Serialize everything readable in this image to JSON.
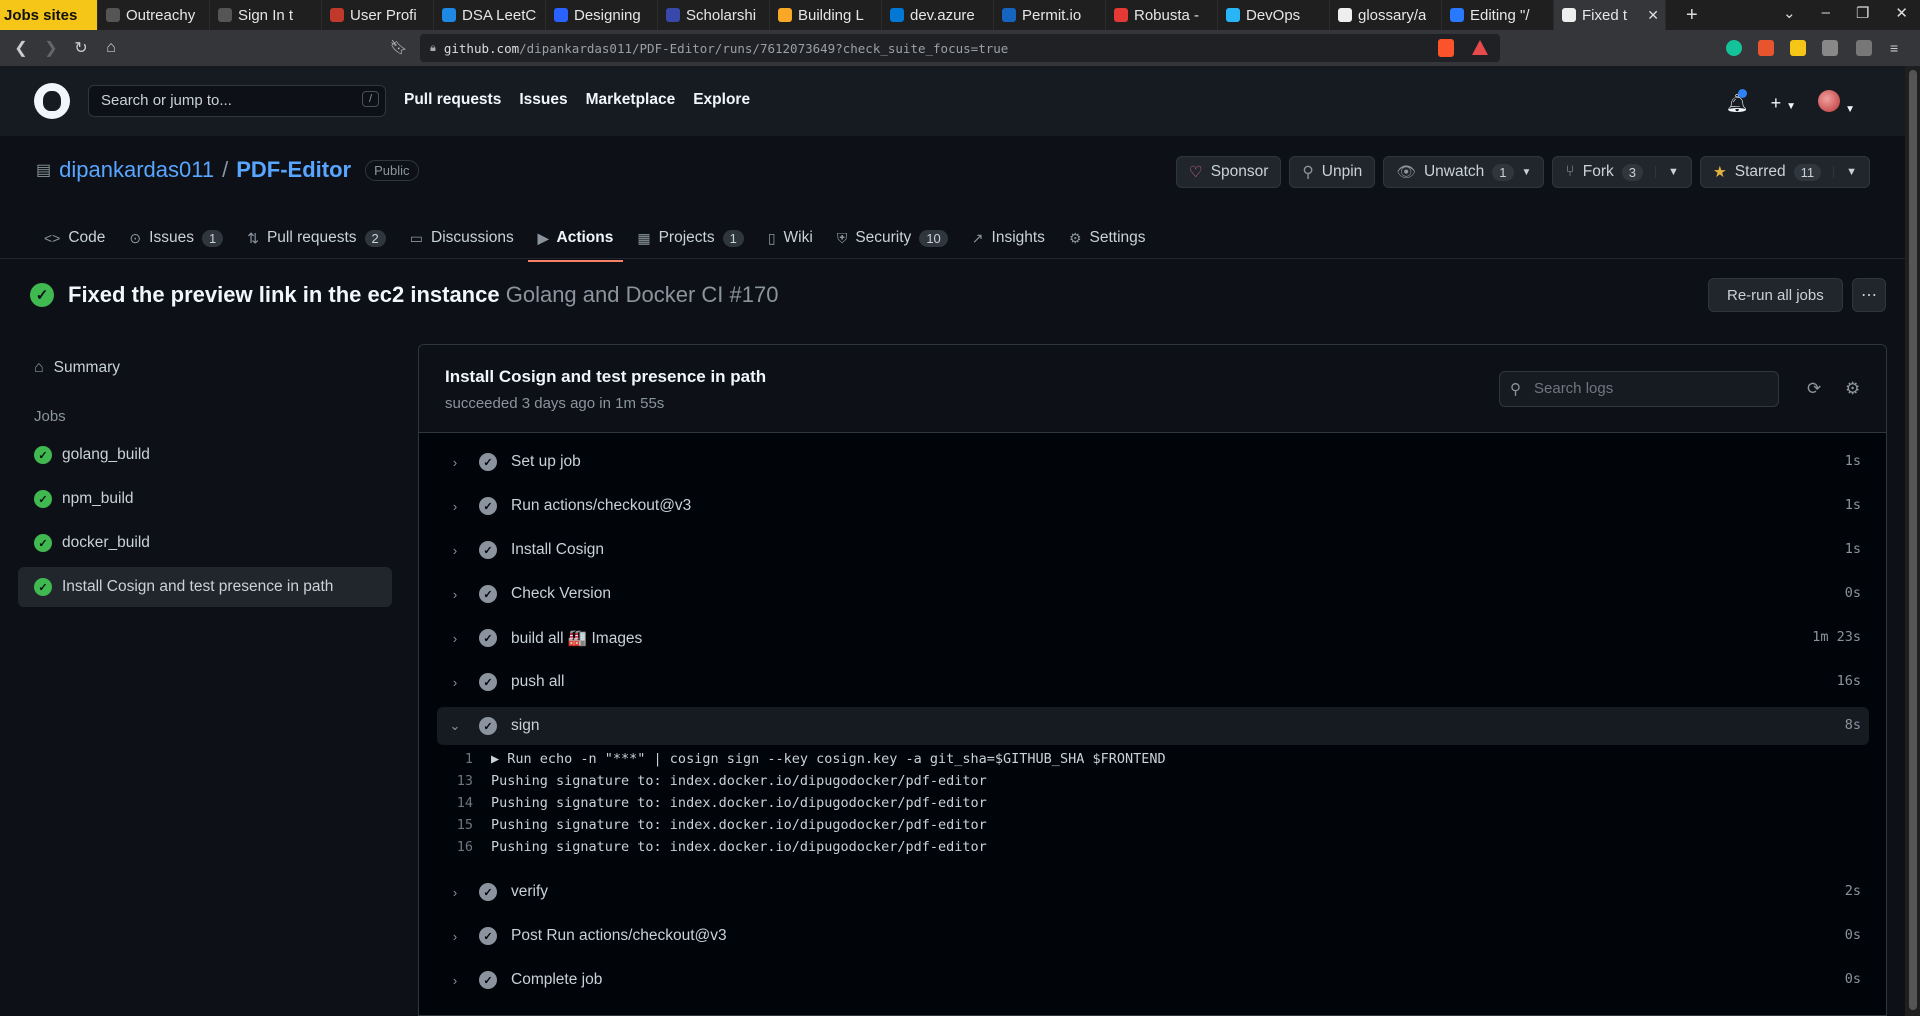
{
  "browser": {
    "tabs": [
      {
        "label": "Jobs sites",
        "color": "#f5c518"
      },
      {
        "label": "Outreachy",
        "color": "#555555"
      },
      {
        "label": "Sign In t",
        "color": "#555555"
      },
      {
        "label": "User Profi",
        "color": "#c0392b"
      },
      {
        "label": "DSA LeetCo",
        "color": "#1e88e5"
      },
      {
        "label": "Designing",
        "color": "#2962ff"
      },
      {
        "label": "Scholarshi",
        "color": "#3949ab"
      },
      {
        "label": "Building L",
        "color": "#f9a825"
      },
      {
        "label": "dev.azure",
        "color": "#0078d4"
      },
      {
        "label": "Permit.io",
        "color": "#1565c0"
      },
      {
        "label": "Robusta -",
        "color": "#e53935"
      },
      {
        "label": "DevOps",
        "color": "#29b6f6"
      },
      {
        "label": "glossary/a",
        "color": "#eeeeee"
      },
      {
        "label": "Editing \"/",
        "color": "#2979ff"
      },
      {
        "label": "Fixed t",
        "color": "#eeeeee"
      }
    ],
    "url_host": "github.com",
    "url_path": "/dipankardas011/PDF-Editor/runs/7612073649?check_suite_focus=true"
  },
  "header": {
    "search_placeholder": "Search or jump to...",
    "search_hint": "/",
    "nav": [
      "Pull requests",
      "Issues",
      "Marketplace",
      "Explore"
    ]
  },
  "repo": {
    "owner": "dipankardas011",
    "separator": "/",
    "name": "PDF-Editor",
    "visibility": "Public",
    "sponsor_label": "Sponsor",
    "unpin_label": "Unpin",
    "watch_label": "Unwatch",
    "watch_count": "1",
    "fork_label": "Fork",
    "fork_count": "3",
    "star_label": "Starred",
    "star_count": "11"
  },
  "repo_tabs": [
    {
      "label": "Code",
      "count": "",
      "icon": "code-icon"
    },
    {
      "label": "Issues",
      "count": "1",
      "icon": "issue-icon"
    },
    {
      "label": "Pull requests",
      "count": "2",
      "icon": "pull-request-icon"
    },
    {
      "label": "Discussions",
      "count": "",
      "icon": "discussion-icon"
    },
    {
      "label": "Actions",
      "count": "",
      "icon": "play-icon"
    },
    {
      "label": "Projects",
      "count": "1",
      "icon": "table-icon"
    },
    {
      "label": "Wiki",
      "count": "",
      "icon": "book-icon"
    },
    {
      "label": "Security",
      "count": "10",
      "icon": "shield-icon"
    },
    {
      "label": "Insights",
      "count": "",
      "icon": "graph-icon"
    },
    {
      "label": "Settings",
      "count": "",
      "icon": "gear-icon"
    }
  ],
  "run": {
    "title": "Fixed the preview link in the ec2 instance",
    "workflow": "Golang and Docker CI #170",
    "rerun_label": "Re-run all jobs"
  },
  "sidebar": {
    "summary_label": "Summary",
    "jobs_heading": "Jobs",
    "jobs": [
      "golang_build",
      "npm_build",
      "docker_build",
      "Install Cosign and test presence in path"
    ]
  },
  "job": {
    "title": "Install Cosign and test presence in path",
    "subtitle": "succeeded 3 days ago in 1m 55s",
    "search_placeholder": "Search logs",
    "steps": [
      {
        "name": "Set up job",
        "duration": "1s"
      },
      {
        "name": "Run actions/checkout@v3",
        "duration": "1s"
      },
      {
        "name": "Install Cosign",
        "duration": "1s"
      },
      {
        "name": "Check Version",
        "duration": "0s"
      },
      {
        "name": "build all 🏭 Images",
        "duration": "1m 23s"
      },
      {
        "name": "push all",
        "duration": "16s"
      },
      {
        "name": "sign",
        "duration": "8s"
      },
      {
        "name": "verify",
        "duration": "2s"
      },
      {
        "name": "Post Run actions/checkout@v3",
        "duration": "0s"
      },
      {
        "name": "Complete job",
        "duration": "0s"
      }
    ],
    "sign_log": [
      {
        "line": "1",
        "text": "▶ Run echo -n \"***\" | cosign sign --key cosign.key -a git_sha=$GITHUB_SHA $FRONTEND"
      },
      {
        "line": "13",
        "text": "Pushing signature to: index.docker.io/dipugodocker/pdf-editor"
      },
      {
        "line": "14",
        "text": "Pushing signature to: index.docker.io/dipugodocker/pdf-editor"
      },
      {
        "line": "15",
        "text": "Pushing signature to: index.docker.io/dipugodocker/pdf-editor"
      },
      {
        "line": "16",
        "text": "Pushing signature to: index.docker.io/dipugodocker/pdf-editor"
      }
    ]
  }
}
